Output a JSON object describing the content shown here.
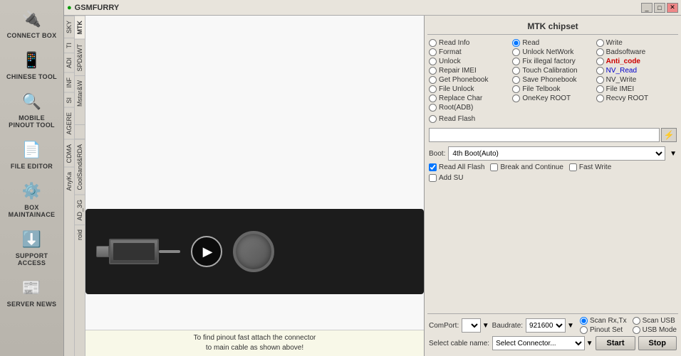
{
  "app": {
    "title": "GSMFURRY",
    "icon": "📱"
  },
  "sidebar": {
    "items": [
      {
        "id": "connect-box",
        "label": "CONNECT BOX",
        "icon": "🔌"
      },
      {
        "id": "chinese-tool",
        "label": "CHINESE TOOL",
        "icon": "📱"
      },
      {
        "id": "mobile-pinout",
        "label": "MOBILE PINOUT TOOL",
        "icon": "🔍"
      },
      {
        "id": "file-editor",
        "label": "FILE EDITOR",
        "icon": "📄"
      },
      {
        "id": "box-maintainace",
        "label": "BOX MAINTAINACE",
        "icon": "⚙️"
      },
      {
        "id": "support-access",
        "label": "SUPPORT ACCESS",
        "icon": "⬇️"
      },
      {
        "id": "server-news",
        "label": "SERVER NEWS",
        "icon": "📰"
      }
    ]
  },
  "tabs": {
    "main": [
      {
        "id": "mtk",
        "label": "MTK",
        "active": true
      }
    ],
    "vertical_col1": [
      "SKY",
      "MTK"
    ],
    "vertical_col2": [
      "TI",
      "SPD&WT"
    ],
    "vertical_col3": [
      "ADI",
      "Mstar&W"
    ],
    "vertical_col4": [
      "INF"
    ],
    "vertical_col5": [
      "SI"
    ],
    "vertical_col6": [
      "AGERE",
      "CoolSand&RDA"
    ],
    "vertical_col7": [
      "CDMA",
      "AD_3G"
    ],
    "vertical_col8": [
      "AnyKa"
    ],
    "vertical_col9": [
      "roid"
    ]
  },
  "panel": {
    "title": "MTK chipset",
    "options": {
      "col1": [
        {
          "id": "read-info",
          "label": "Read Info",
          "checked": false
        },
        {
          "id": "format",
          "label": "Format",
          "checked": false
        },
        {
          "id": "unlock",
          "label": "Unlock",
          "checked": false
        },
        {
          "id": "repair-imei",
          "label": "Repair IMEI",
          "checked": false
        },
        {
          "id": "get-phonebook",
          "label": "Get Phonebook",
          "checked": false
        },
        {
          "id": "file-unlock",
          "label": "File Unlock",
          "checked": false
        },
        {
          "id": "replace-char",
          "label": "Replace Char",
          "checked": false
        },
        {
          "id": "root-adb",
          "label": "Root(ADB)",
          "checked": false
        }
      ],
      "col2": [
        {
          "id": "read",
          "label": "Read",
          "checked": true
        },
        {
          "id": "unlock-network",
          "label": "Unlock NetWork",
          "checked": false
        },
        {
          "id": "fix-illegal-factory",
          "label": "Fix illegal factory",
          "checked": false
        },
        {
          "id": "touch-calibration",
          "label": "Touch Calibration",
          "checked": false
        },
        {
          "id": "save-phonebook",
          "label": "Save Phonebook",
          "checked": false
        },
        {
          "id": "file-telbook",
          "label": "File Telbook",
          "checked": false
        },
        {
          "id": "onekey-root",
          "label": "OneKey ROOT",
          "checked": false
        }
      ],
      "col3": [
        {
          "id": "write",
          "label": "Write",
          "checked": false
        },
        {
          "id": "badsoftware",
          "label": "Badsoftware",
          "checked": false
        },
        {
          "id": "anti-code",
          "label": "Anti_code",
          "checked": false,
          "highlight": true
        },
        {
          "id": "nv-read",
          "label": "NV_Read",
          "checked": false,
          "blue": true
        },
        {
          "id": "nv-write",
          "label": "NV_Write",
          "checked": false
        },
        {
          "id": "file-imei",
          "label": "File IMEI",
          "checked": false
        },
        {
          "id": "recvy-root",
          "label": "Recvy ROOT",
          "checked": false
        }
      ]
    },
    "read_flash": {
      "label": "Read Flash",
      "id": "read-flash"
    },
    "search_placeholder": "",
    "boot": {
      "label": "Boot:",
      "value": "4th Boot(Auto)"
    },
    "checkboxes": [
      {
        "id": "read-all-flash",
        "label": "Read All Flash",
        "checked": true
      },
      {
        "id": "break-and-continue",
        "label": "Break and Continue",
        "checked": false
      },
      {
        "id": "fast-write",
        "label": "Fast Write",
        "checked": false
      },
      {
        "id": "add-su",
        "label": "Add SU",
        "checked": false
      }
    ],
    "com": {
      "label": "ComPort:",
      "value": "",
      "placeholder": ""
    },
    "baudrate": {
      "label": "Baudrate:",
      "value": "921600"
    },
    "scan_options": [
      {
        "id": "scan-rxtx",
        "label": "Scan Rx,Tx",
        "checked": true
      },
      {
        "id": "pinout-set",
        "label": "Pinout Set",
        "checked": false
      }
    ],
    "scan_options2": [
      {
        "id": "scan-usb",
        "label": "Scan USB",
        "checked": false
      },
      {
        "id": "usb-mode",
        "label": "USB Mode",
        "checked": false
      }
    ],
    "cable": {
      "label": "Select cable name:",
      "placeholder": "Select Connector..."
    },
    "buttons": {
      "start": "Start",
      "stop": "Stop"
    }
  },
  "hint": {
    "line1": "To find pinout fast attach the connector",
    "line2": "to main cable as shown above!"
  }
}
